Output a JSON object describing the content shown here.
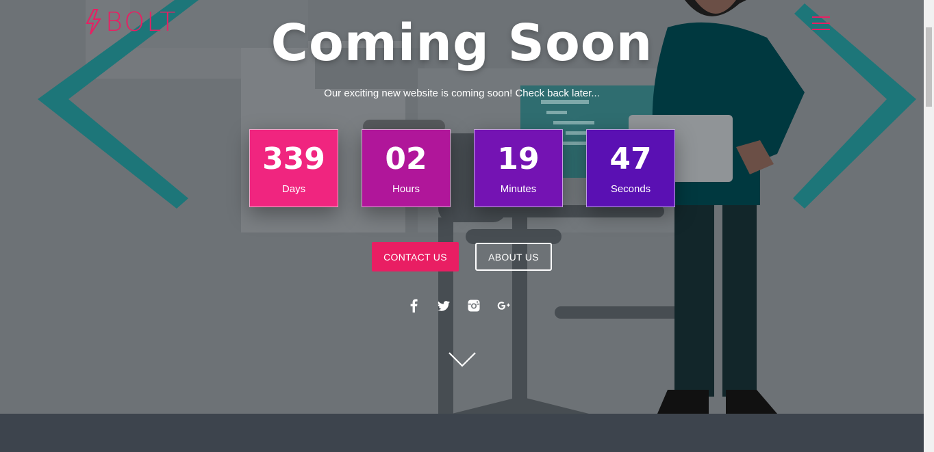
{
  "brand": {
    "name": "BOLT",
    "accent": "#e91e63"
  },
  "hero": {
    "title": "Coming Soon",
    "subtitle": "Our exciting new website is coming soon! Check back later..."
  },
  "countdown": [
    {
      "value": "339",
      "label": "Days",
      "color": "#f0257f"
    },
    {
      "value": "02",
      "label": "Hours",
      "color": "#b0169a"
    },
    {
      "value": "19",
      "label": "Minutes",
      "color": "#7413b3"
    },
    {
      "value": "47",
      "label": "Seconds",
      "color": "#5a10b3"
    }
  ],
  "buttons": {
    "contact": "CONTACT US",
    "about": "ABOUT US"
  },
  "social": [
    "facebook-icon",
    "twitter-icon",
    "instagram-icon",
    "google-plus-icon"
  ],
  "icons": {
    "menu": "hamburger-menu-icon",
    "scroll": "chevron-down-icon"
  }
}
